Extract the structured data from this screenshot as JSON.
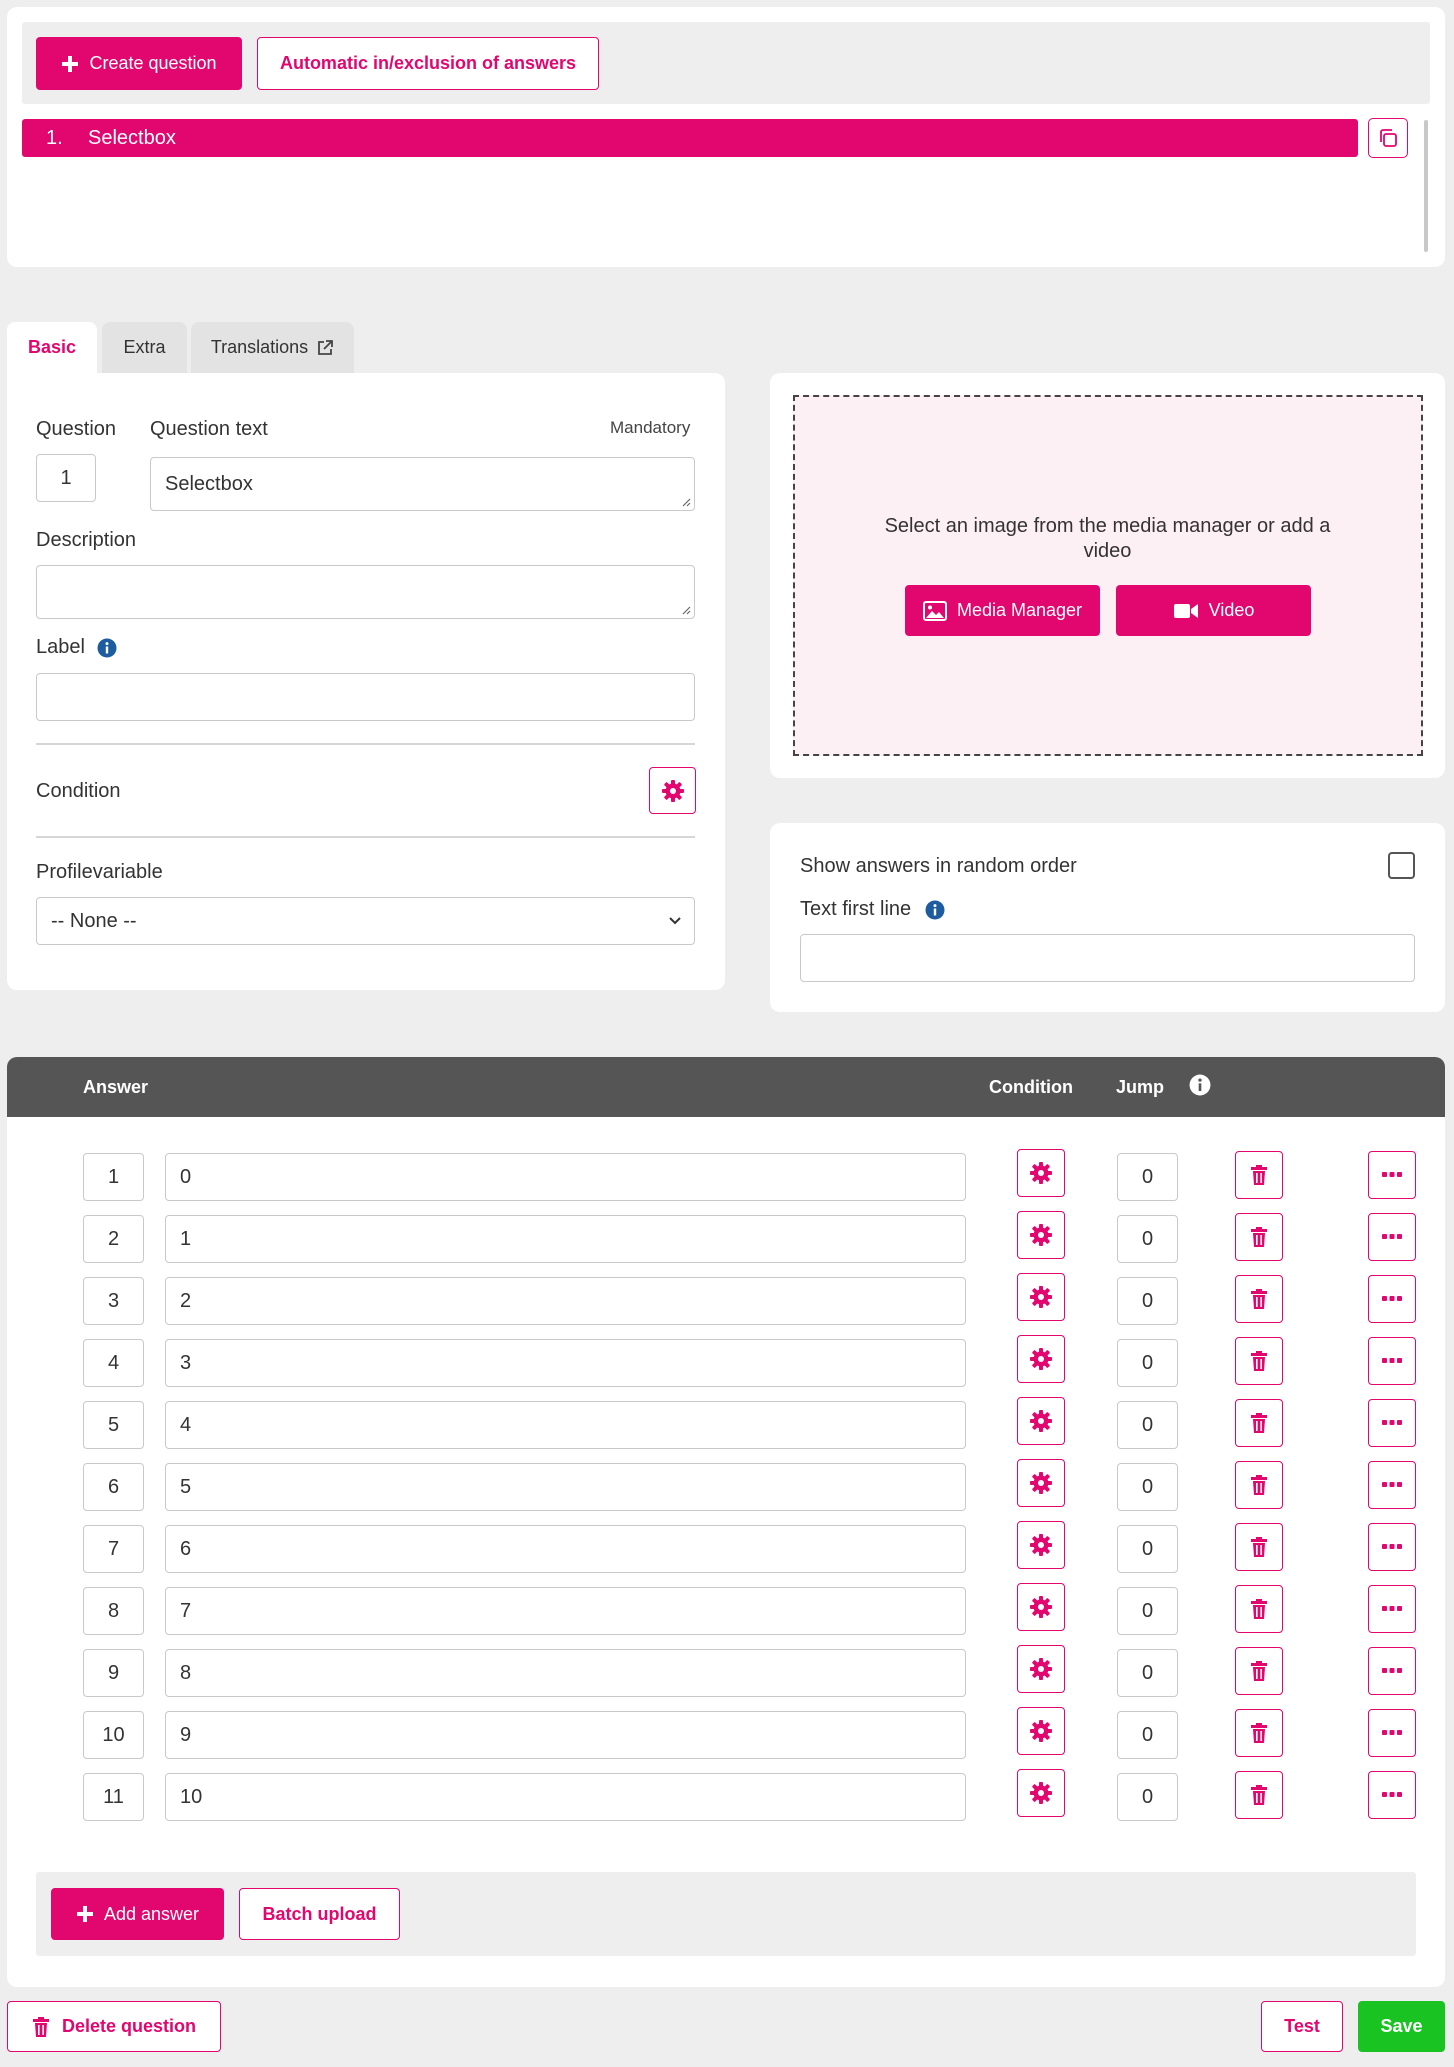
{
  "toolbar": {
    "create_question": "Create question",
    "auto_inclusion": "Automatic in/exclusion of answers"
  },
  "question_list": [
    {
      "number": "1.",
      "title": "Selectbox"
    }
  ],
  "tabs": [
    {
      "label": "Basic",
      "active": true
    },
    {
      "label": "Extra",
      "active": false
    },
    {
      "label": "Translations",
      "active": false
    }
  ],
  "form": {
    "question_label": "Question",
    "question_text_label": "Question text",
    "mandatory_label": "Mandatory",
    "question_number": "1",
    "question_text": "Selectbox",
    "description_label": "Description",
    "description_value": "",
    "label_label": "Label",
    "label_value": "",
    "condition_label": "Condition",
    "profilevariable_label": "Profilevariable",
    "profilevariable_value": "-- None --"
  },
  "media": {
    "prompt": "Select an image from the media manager or add a video",
    "media_manager": "Media Manager",
    "video": "Video"
  },
  "options": {
    "random_order_label": "Show answers in random order",
    "random_order_checked": false,
    "text_first_line_label": "Text first line",
    "text_first_line_value": ""
  },
  "answers_table": {
    "headers": {
      "answer": "Answer",
      "condition": "Condition",
      "jump": "Jump"
    },
    "rows": [
      {
        "num": "1",
        "text": "0",
        "jump": "0"
      },
      {
        "num": "2",
        "text": "1",
        "jump": "0"
      },
      {
        "num": "3",
        "text": "2",
        "jump": "0"
      },
      {
        "num": "4",
        "text": "3",
        "jump": "0"
      },
      {
        "num": "5",
        "text": "4",
        "jump": "0"
      },
      {
        "num": "6",
        "text": "5",
        "jump": "0"
      },
      {
        "num": "7",
        "text": "6",
        "jump": "0"
      },
      {
        "num": "8",
        "text": "7",
        "jump": "0"
      },
      {
        "num": "9",
        "text": "8",
        "jump": "0"
      },
      {
        "num": "10",
        "text": "9",
        "jump": "0"
      },
      {
        "num": "11",
        "text": "10",
        "jump": "0"
      }
    ],
    "add_answer": "Add answer",
    "batch_upload": "Batch upload"
  },
  "footer": {
    "delete_question": "Delete question",
    "test": "Test",
    "save": "Save"
  },
  "colors": {
    "accent": "#e2066f",
    "header_bg": "#555555",
    "save": "#18c322",
    "dropzone_bg": "#fdf0f5",
    "info": "#1d5c9f"
  },
  "icons": {
    "plus": "plus-icon",
    "copy": "copy-icon",
    "external": "external-link-icon",
    "info": "info-icon",
    "gear": "gear-icon",
    "image": "image-icon",
    "video": "video-camera-icon",
    "trash": "trash-icon",
    "more": "ellipsis-icon",
    "chevron": "chevron-down-icon"
  }
}
